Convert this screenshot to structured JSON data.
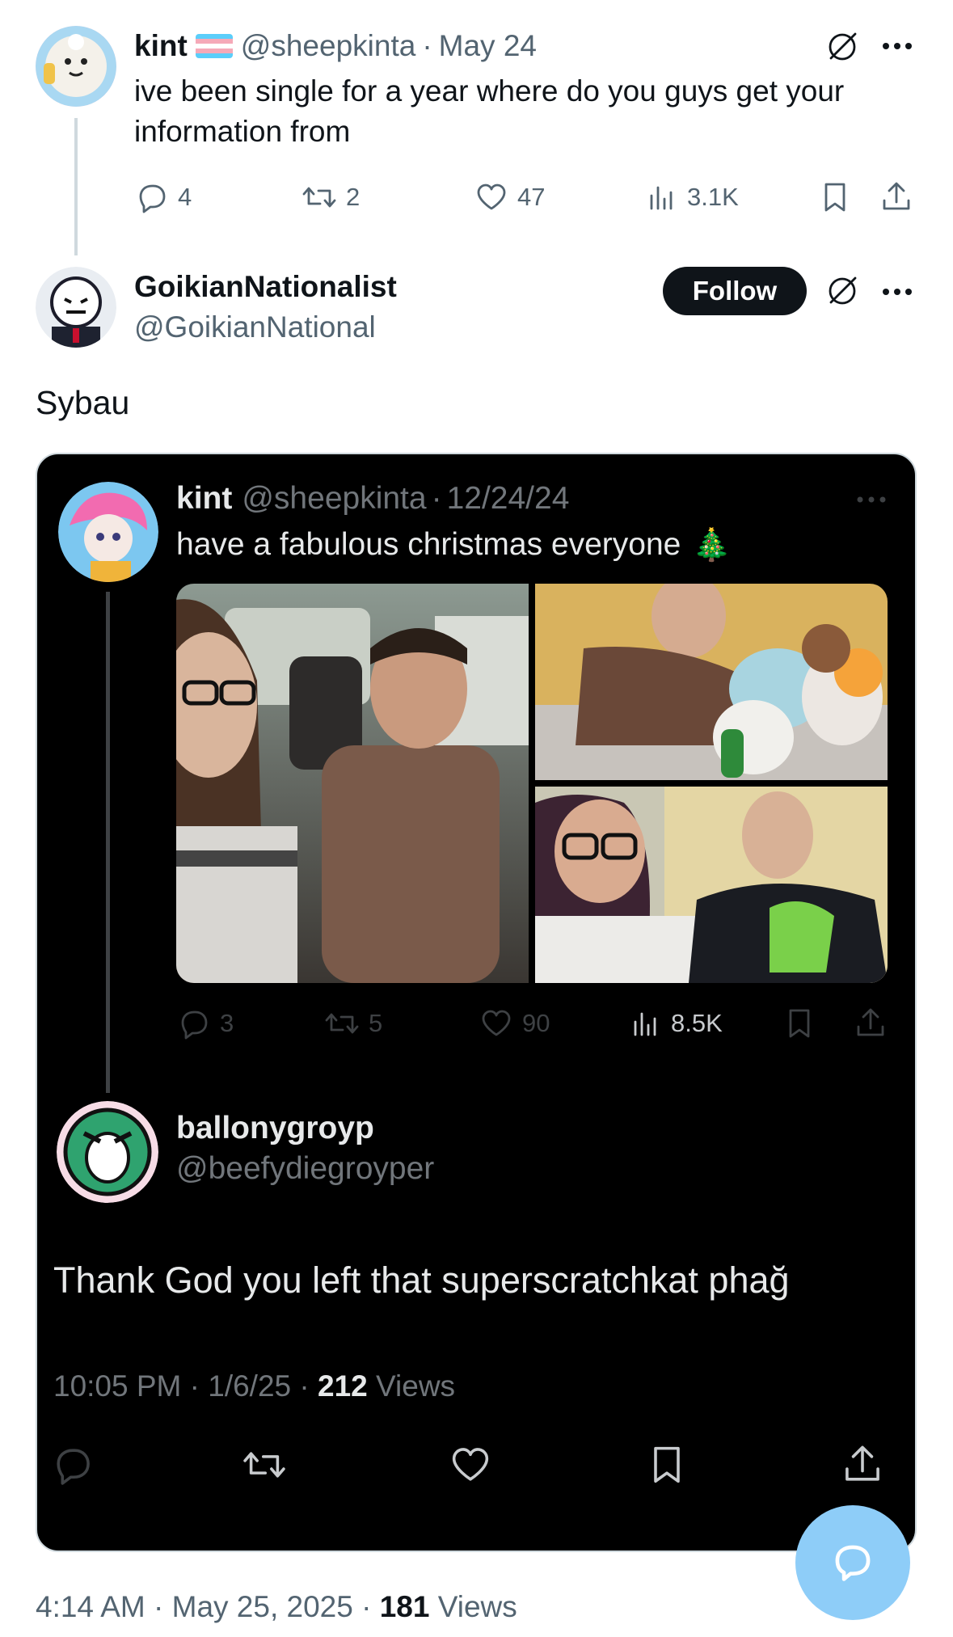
{
  "parent_tweet": {
    "display_name": "kint",
    "flag": "trans-flag",
    "handle": "@sheepkinta",
    "sep": "·",
    "date": "May 24",
    "text_line1": "ive been single for a year where do you guys get your",
    "text_line2": "information from",
    "replies": "4",
    "reposts": "2",
    "likes": "47",
    "views": "3.1K"
  },
  "main_tweet": {
    "display_name": "GoikianNationalist",
    "handle": "@GoikianNational",
    "follow_label": "Follow",
    "text": "Sybau",
    "timestamp": "4:14 AM · May 25, 2025 · ",
    "views_count": "181",
    "views_label": " Views"
  },
  "embedded": {
    "inner_tweet": {
      "display_name": "kint",
      "handle": "@sheepkinta",
      "sep": "·",
      "date": "12/24/24",
      "text": "have a fabulous christmas everyone",
      "emoji": "🎄",
      "replies": "3",
      "reposts": "5",
      "likes": "90",
      "views": "8.5K"
    },
    "reply": {
      "display_name": "ballonygroyp",
      "handle": "@beefydiegroyper",
      "text": "Thank God you left that superscratchkat phağ",
      "timestamp": "10:05 PM · 1/6/25 · ",
      "views_count": "212",
      "views_label": " Views"
    }
  },
  "icons": [
    "grok-icon",
    "more-icon",
    "reply-icon",
    "repost-icon",
    "like-icon",
    "views-icon",
    "bookmark-icon",
    "share-icon",
    "compose-message-icon"
  ],
  "colors": {
    "accent": "#8ecdf8",
    "text": "#0f1419",
    "muted": "#536471",
    "dark_card": "#000000"
  }
}
